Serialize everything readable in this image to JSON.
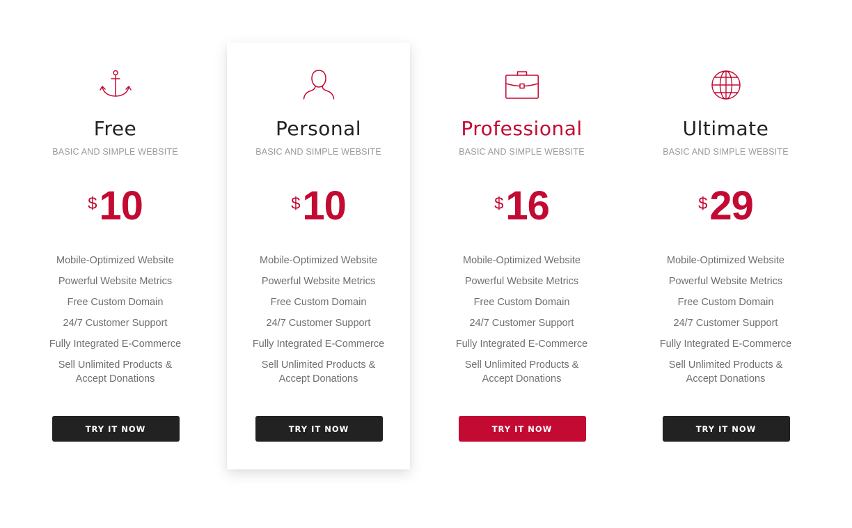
{
  "colors": {
    "accent": "#c20a33",
    "dark": "#222222",
    "muted": "#9a9a9a",
    "feature_text": "#6f6f6f"
  },
  "plans": [
    {
      "icon": "anchor-icon",
      "name": "Free",
      "subtitle": "BASIC AND SIMPLE WEBSITE",
      "currency": "$",
      "price": "10",
      "features": [
        "Mobile-Optimized Website",
        "Powerful Website Metrics",
        "Free Custom Domain",
        "24/7 Customer Support",
        "Fully Integrated E-Commerce",
        "Sell Unlimited Products & Accept Donations"
      ],
      "button": "TRY IT NOW"
    },
    {
      "icon": "user-icon",
      "name": "Personal",
      "subtitle": "BASIC AND SIMPLE WEBSITE",
      "currency": "$",
      "price": "10",
      "features": [
        "Mobile-Optimized Website",
        "Powerful Website Metrics",
        "Free Custom Domain",
        "24/7 Customer Support",
        "Fully Integrated E-Commerce",
        "Sell Unlimited Products & Accept Donations"
      ],
      "button": "TRY IT NOW"
    },
    {
      "icon": "briefcase-icon",
      "name": "Professional",
      "subtitle": "BASIC AND SIMPLE WEBSITE",
      "currency": "$",
      "price": "16",
      "features": [
        "Mobile-Optimized Website",
        "Powerful Website Metrics",
        "Free Custom Domain",
        "24/7 Customer Support",
        "Fully Integrated E-Commerce",
        "Sell Unlimited Products & Accept Donations"
      ],
      "button": "TRY IT NOW"
    },
    {
      "icon": "globe-icon",
      "name": "Ultimate",
      "subtitle": "BASIC AND SIMPLE WEBSITE",
      "currency": "$",
      "price": "29",
      "features": [
        "Mobile-Optimized Website",
        "Powerful Website Metrics",
        "Free Custom Domain",
        "24/7 Customer Support",
        "Fully Integrated E-Commerce",
        "Sell Unlimited Products & Accept Donations"
      ],
      "button": "TRY IT NOW"
    }
  ]
}
